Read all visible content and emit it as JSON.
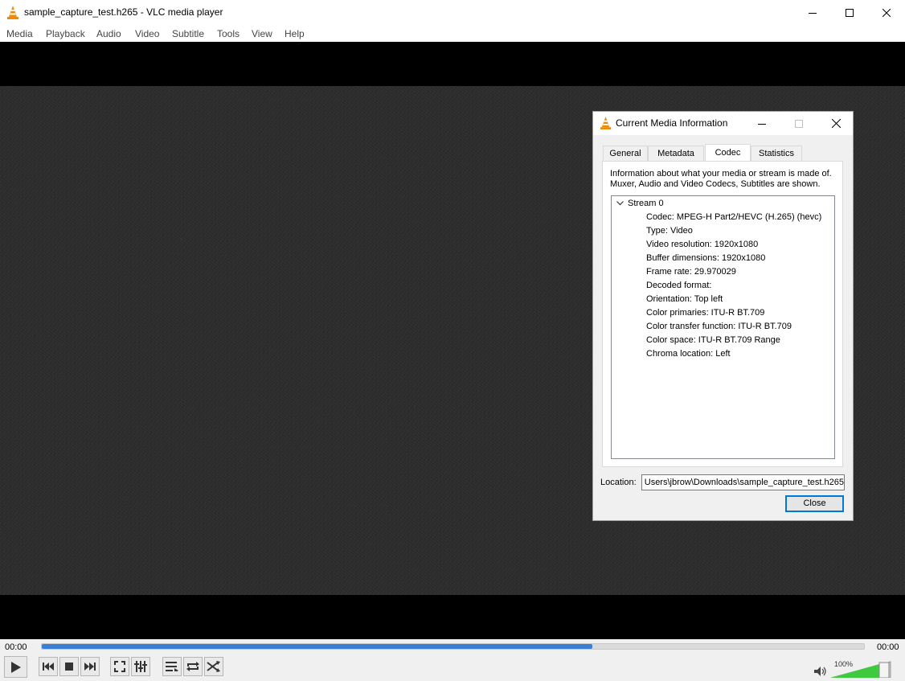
{
  "window": {
    "title": "sample_capture_test.h265 - VLC media player",
    "controls": [
      "minimize",
      "maximize",
      "close"
    ]
  },
  "menu": [
    "Media",
    "Playback",
    "Audio",
    "Video",
    "Subtitle",
    "Tools",
    "View",
    "Help"
  ],
  "dialog": {
    "title": "Current Media Information",
    "tabs": [
      "General",
      "Metadata",
      "Codec",
      "Statistics"
    ],
    "active_tab": "Codec",
    "description": "Information about what your media or stream is made of. Muxer, Audio and Video Codecs, Subtitles are shown.",
    "stream_label": "Stream 0",
    "stream_items": [
      "Codec: MPEG-H Part2/HEVC (H.265) (hevc)",
      "Type: Video",
      "Video resolution: 1920x1080",
      "Buffer dimensions: 1920x1080",
      "Frame rate: 29.970029",
      "Decoded format:",
      "Orientation: Top left",
      "Color primaries: ITU-R BT.709",
      "Color transfer function: ITU-R BT.709",
      "Color space: ITU-R BT.709 Range",
      "Chroma location: Left"
    ],
    "location_label": "Location:",
    "location_value": "Users\\jbrow\\Downloads\\sample_capture_test.h265",
    "close_label": "Close"
  },
  "playback": {
    "elapsed": "00:00",
    "total": "00:00",
    "progress_fraction": 0.67,
    "volume_label": "100%",
    "volume_fraction": 1.0
  },
  "colors": {
    "seek_fill": "#3b7fd4",
    "volume_fill": "#3fc93f",
    "vlc_orange": "#f08a00"
  },
  "icons": {
    "app": "vlc-cone-icon",
    "play": "play-icon",
    "prev": "previous-icon",
    "stop": "stop-icon",
    "next": "next-icon",
    "fullscreen": "fullscreen-icon",
    "extended": "extended-settings-icon",
    "playlist": "playlist-icon",
    "loop": "loop-icon",
    "shuffle": "shuffle-icon",
    "volume": "speaker-icon"
  }
}
